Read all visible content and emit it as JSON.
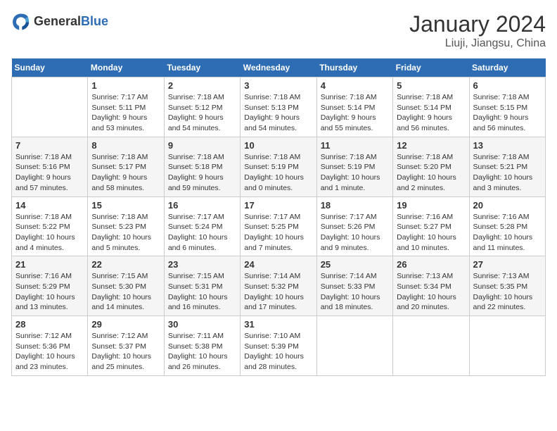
{
  "header": {
    "logo_general": "General",
    "logo_blue": "Blue",
    "title": "January 2024",
    "subtitle": "Liuji, Jiangsu, China"
  },
  "calendar": {
    "days_of_week": [
      "Sunday",
      "Monday",
      "Tuesday",
      "Wednesday",
      "Thursday",
      "Friday",
      "Saturday"
    ],
    "weeks": [
      [
        {
          "num": "",
          "info": ""
        },
        {
          "num": "1",
          "info": "Sunrise: 7:17 AM\nSunset: 5:11 PM\nDaylight: 9 hours\nand 53 minutes."
        },
        {
          "num": "2",
          "info": "Sunrise: 7:18 AM\nSunset: 5:12 PM\nDaylight: 9 hours\nand 54 minutes."
        },
        {
          "num": "3",
          "info": "Sunrise: 7:18 AM\nSunset: 5:13 PM\nDaylight: 9 hours\nand 54 minutes."
        },
        {
          "num": "4",
          "info": "Sunrise: 7:18 AM\nSunset: 5:14 PM\nDaylight: 9 hours\nand 55 minutes."
        },
        {
          "num": "5",
          "info": "Sunrise: 7:18 AM\nSunset: 5:14 PM\nDaylight: 9 hours\nand 56 minutes."
        },
        {
          "num": "6",
          "info": "Sunrise: 7:18 AM\nSunset: 5:15 PM\nDaylight: 9 hours\nand 56 minutes."
        }
      ],
      [
        {
          "num": "7",
          "info": "Sunrise: 7:18 AM\nSunset: 5:16 PM\nDaylight: 9 hours\nand 57 minutes."
        },
        {
          "num": "8",
          "info": "Sunrise: 7:18 AM\nSunset: 5:17 PM\nDaylight: 9 hours\nand 58 minutes."
        },
        {
          "num": "9",
          "info": "Sunrise: 7:18 AM\nSunset: 5:18 PM\nDaylight: 9 hours\nand 59 minutes."
        },
        {
          "num": "10",
          "info": "Sunrise: 7:18 AM\nSunset: 5:19 PM\nDaylight: 10 hours\nand 0 minutes."
        },
        {
          "num": "11",
          "info": "Sunrise: 7:18 AM\nSunset: 5:19 PM\nDaylight: 10 hours\nand 1 minute."
        },
        {
          "num": "12",
          "info": "Sunrise: 7:18 AM\nSunset: 5:20 PM\nDaylight: 10 hours\nand 2 minutes."
        },
        {
          "num": "13",
          "info": "Sunrise: 7:18 AM\nSunset: 5:21 PM\nDaylight: 10 hours\nand 3 minutes."
        }
      ],
      [
        {
          "num": "14",
          "info": "Sunrise: 7:18 AM\nSunset: 5:22 PM\nDaylight: 10 hours\nand 4 minutes."
        },
        {
          "num": "15",
          "info": "Sunrise: 7:18 AM\nSunset: 5:23 PM\nDaylight: 10 hours\nand 5 minutes."
        },
        {
          "num": "16",
          "info": "Sunrise: 7:17 AM\nSunset: 5:24 PM\nDaylight: 10 hours\nand 6 minutes."
        },
        {
          "num": "17",
          "info": "Sunrise: 7:17 AM\nSunset: 5:25 PM\nDaylight: 10 hours\nand 7 minutes."
        },
        {
          "num": "18",
          "info": "Sunrise: 7:17 AM\nSunset: 5:26 PM\nDaylight: 10 hours\nand 9 minutes."
        },
        {
          "num": "19",
          "info": "Sunrise: 7:16 AM\nSunset: 5:27 PM\nDaylight: 10 hours\nand 10 minutes."
        },
        {
          "num": "20",
          "info": "Sunrise: 7:16 AM\nSunset: 5:28 PM\nDaylight: 10 hours\nand 11 minutes."
        }
      ],
      [
        {
          "num": "21",
          "info": "Sunrise: 7:16 AM\nSunset: 5:29 PM\nDaylight: 10 hours\nand 13 minutes."
        },
        {
          "num": "22",
          "info": "Sunrise: 7:15 AM\nSunset: 5:30 PM\nDaylight: 10 hours\nand 14 minutes."
        },
        {
          "num": "23",
          "info": "Sunrise: 7:15 AM\nSunset: 5:31 PM\nDaylight: 10 hours\nand 16 minutes."
        },
        {
          "num": "24",
          "info": "Sunrise: 7:14 AM\nSunset: 5:32 PM\nDaylight: 10 hours\nand 17 minutes."
        },
        {
          "num": "25",
          "info": "Sunrise: 7:14 AM\nSunset: 5:33 PM\nDaylight: 10 hours\nand 18 minutes."
        },
        {
          "num": "26",
          "info": "Sunrise: 7:13 AM\nSunset: 5:34 PM\nDaylight: 10 hours\nand 20 minutes."
        },
        {
          "num": "27",
          "info": "Sunrise: 7:13 AM\nSunset: 5:35 PM\nDaylight: 10 hours\nand 22 minutes."
        }
      ],
      [
        {
          "num": "28",
          "info": "Sunrise: 7:12 AM\nSunset: 5:36 PM\nDaylight: 10 hours\nand 23 minutes."
        },
        {
          "num": "29",
          "info": "Sunrise: 7:12 AM\nSunset: 5:37 PM\nDaylight: 10 hours\nand 25 minutes."
        },
        {
          "num": "30",
          "info": "Sunrise: 7:11 AM\nSunset: 5:38 PM\nDaylight: 10 hours\nand 26 minutes."
        },
        {
          "num": "31",
          "info": "Sunrise: 7:10 AM\nSunset: 5:39 PM\nDaylight: 10 hours\nand 28 minutes."
        },
        {
          "num": "",
          "info": ""
        },
        {
          "num": "",
          "info": ""
        },
        {
          "num": "",
          "info": ""
        }
      ]
    ]
  }
}
